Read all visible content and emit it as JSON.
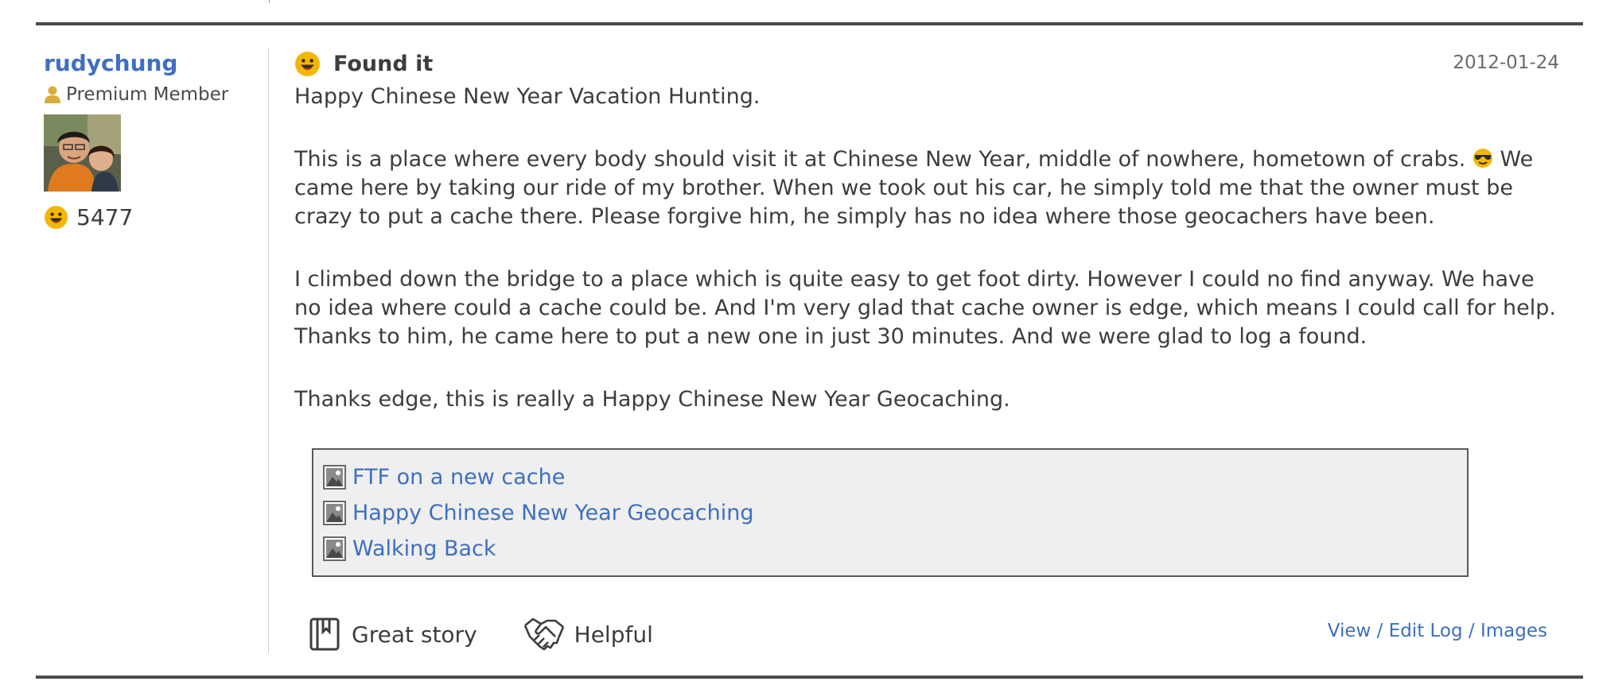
{
  "profile": {
    "username": "rudychung",
    "member_type": "Premium Member",
    "finds_count": "5477"
  },
  "log": {
    "type": "Found it",
    "date": "2012-01-24",
    "paragraphs": [
      "Happy Chinese New Year Vacation Hunting.",
      "This is a place where every body should visit it at Chinese New Year, middle of nowhere, hometown of crabs.",
      "We came here by taking our ride of my brother. When we took out his car, he simply told me that the owner must be crazy to put a cache there. Please forgive him, he simply has no idea where those geocachers have been.",
      "I climbed down the bridge to a place which is quite easy to get foot dirty. However I could no find anyway. We have no idea where could a cache could be. And I'm very glad that cache owner is edge, which means I could call for help. Thanks to him, he came here to put a new one in just 30 minutes. And we were glad to log a found.",
      "Thanks edge, this is really a Happy Chinese New Year Geocaching."
    ],
    "images": [
      {
        "label": "FTF on a new cache",
        "icon": "image-icon"
      },
      {
        "label": "Happy Chinese New Year Geocaching",
        "icon": "image-icon"
      },
      {
        "label": "Walking Back",
        "icon": "image-icon"
      }
    ],
    "actions": {
      "great_story": "Great story",
      "helpful": "Helpful",
      "view_edit": "View / Edit Log / Images"
    }
  },
  "icons": {
    "log_type": "smiley-icon",
    "member": "person-icon",
    "great_story": "bookmark-book-icon",
    "helpful": "handshake-icon",
    "inline_emoji": "sunglasses-icon"
  },
  "colors": {
    "link": "#3f6fbf",
    "text": "#3d3d3d",
    "smiley": "#f2b705",
    "member_icon": "#d9ad3c",
    "images_box_bg": "#efefef"
  }
}
